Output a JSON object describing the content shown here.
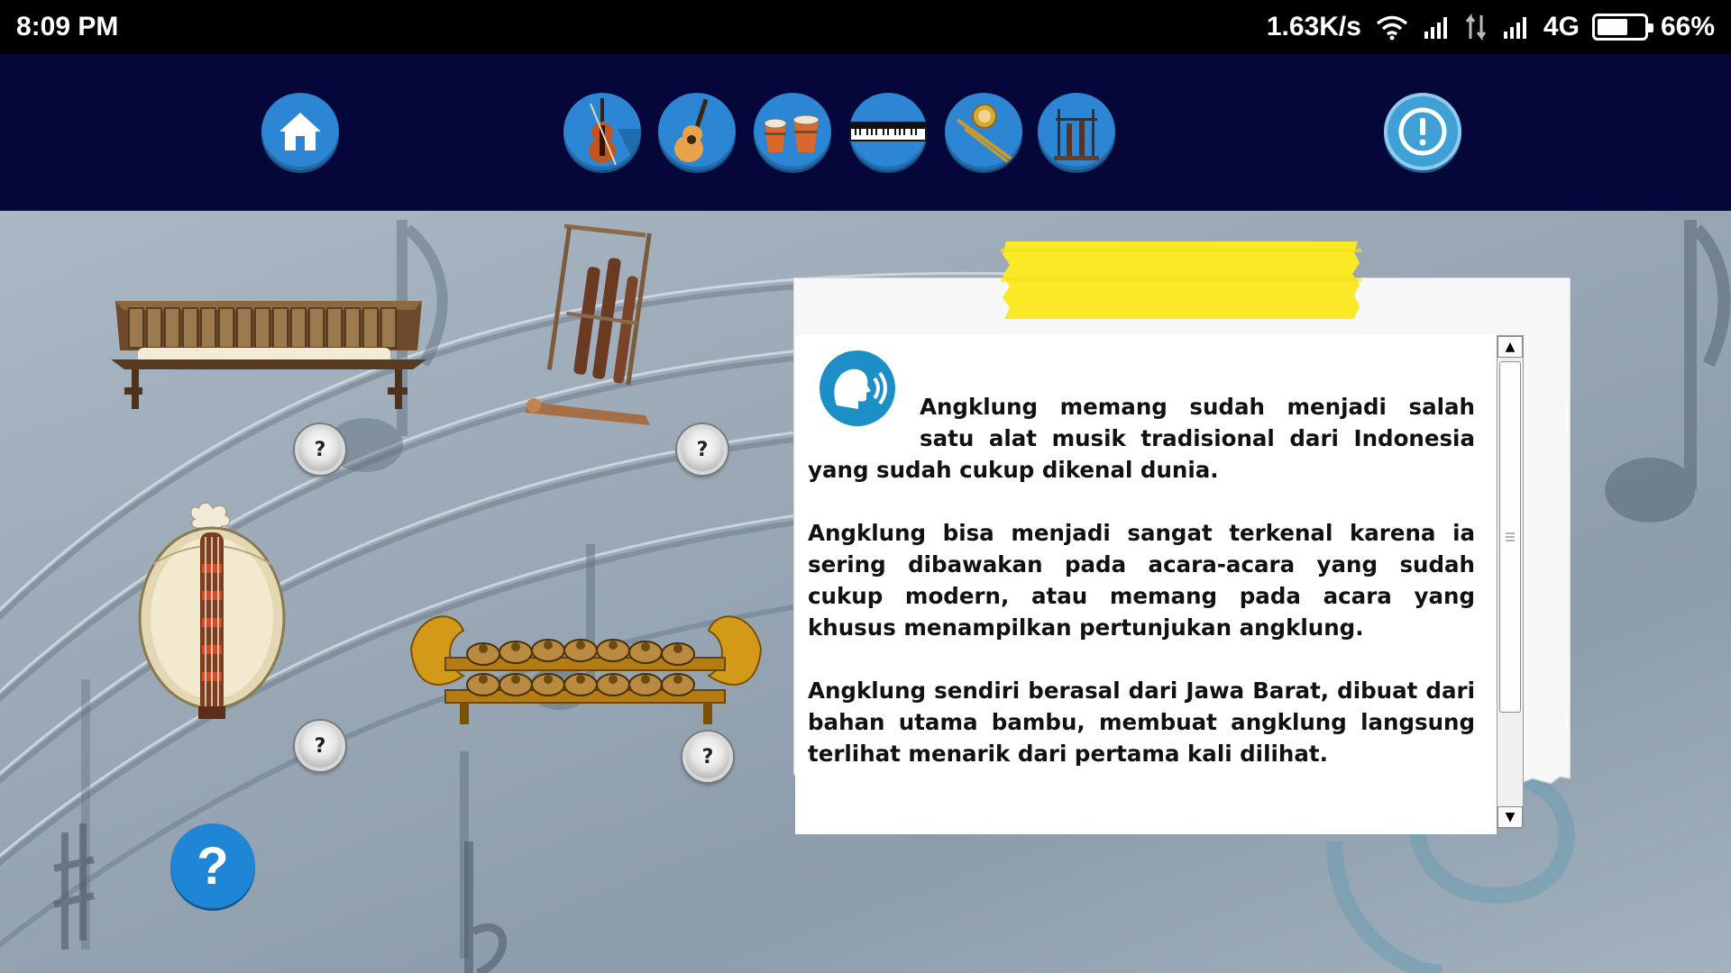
{
  "status_bar": {
    "time": "8:09 PM",
    "net_speed": "1.63K/s",
    "network_type": "4G",
    "battery": "66%",
    "battery_level": 0.66
  },
  "nav": {
    "items": [
      {
        "name": "home",
        "icon": "home-icon"
      },
      {
        "name": "violin",
        "icon": "violin-icon"
      },
      {
        "name": "guitar",
        "icon": "guitar-icon"
      },
      {
        "name": "drums",
        "icon": "bongo-drums-icon"
      },
      {
        "name": "keyboard",
        "icon": "piano-keyboard-icon"
      },
      {
        "name": "trombone",
        "icon": "trombone-icon"
      },
      {
        "name": "angklung",
        "icon": "angklung-icon"
      },
      {
        "name": "about",
        "icon": "exclamation-icon"
      }
    ]
  },
  "instruments": [
    {
      "name": "gambang",
      "info_label": "?"
    },
    {
      "name": "angklung",
      "info_label": "?"
    },
    {
      "name": "sasando",
      "info_label": "?"
    },
    {
      "name": "bonang",
      "info_label": "?"
    }
  ],
  "help": {
    "label": "?"
  },
  "article": {
    "paragraphs": [
      "Angklung memang sudah menjadi salah satu alat musik tradisional dari Indonesia yang sudah cukup dikenal dunia.",
      "Angklung bisa menjadi sangat terkenal karena ia sering dibawakan pada acara-acara yang sudah cukup modern, atau memang pada acara yang khusus menampilkan pertunjukan angklung.",
      "Angklung sendiri berasal dari Jawa Barat, dibuat dari bahan utama bambu, membuat angklung langsung terlihat menarik dari pertama kali dilihat."
    ]
  },
  "colors": {
    "nav_bg": "#05073a",
    "button_blue": "#2c86d4",
    "tape_yellow": "#fbe928"
  }
}
